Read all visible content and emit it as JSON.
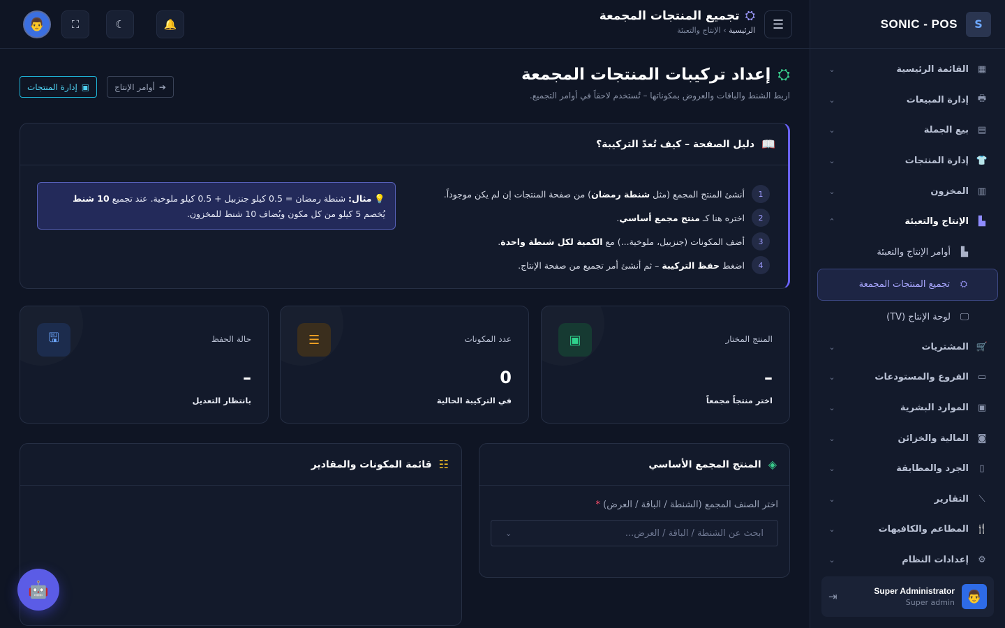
{
  "brand": {
    "name": "SONIC - POS",
    "logo_letter": "S"
  },
  "sidebar": {
    "items": [
      {
        "icon": "▦",
        "label": "القائمة الرئيسية",
        "chevron": "⌄"
      },
      {
        "icon": "🖶",
        "label": "إدارة المبيعات",
        "chevron": "⌄"
      },
      {
        "icon": "▤",
        "label": "بيع الجملة",
        "chevron": "⌄"
      },
      {
        "icon": "👕",
        "label": "إدارة المنتجات",
        "chevron": "⌄"
      },
      {
        "icon": "▥",
        "label": "المخزون",
        "chevron": "⌄"
      },
      {
        "icon": "▙",
        "label": "الإنتاج والتعبئة",
        "chevron": "⌃"
      }
    ],
    "sub_items": [
      {
        "icon": "▙",
        "label": "أوامر الإنتاج والتعبئة"
      },
      {
        "icon": "⛭",
        "label": "تجميع المنتجات المجمعة"
      },
      {
        "icon": "🖵",
        "label": "لوحة الإنتاج (TV)"
      }
    ],
    "items_after": [
      {
        "icon": "🛒",
        "label": "المشتريات",
        "chevron": "⌄"
      },
      {
        "icon": "▭",
        "label": "الفروع والمستودعات",
        "chevron": "⌄"
      },
      {
        "icon": "▣",
        "label": "الموارد البشرية",
        "chevron": "⌄"
      },
      {
        "icon": "◙",
        "label": "المالية والخزائن",
        "chevron": "⌄"
      },
      {
        "icon": "▯",
        "label": "الجرد والمطابقة",
        "chevron": "⌄"
      },
      {
        "icon": "⟋",
        "label": "التقارير",
        "chevron": "⌄"
      },
      {
        "icon": "🍴",
        "label": "المطاعم والكافيهات",
        "chevron": "⌄"
      },
      {
        "icon": "⚙",
        "label": "إعدادات النظام",
        "chevron": "⌄"
      }
    ]
  },
  "user": {
    "name": "Super Administrator",
    "role": "Super admin",
    "avatar": "👨",
    "logout_icon": "⇥"
  },
  "topbar": {
    "menu_icon": "☰",
    "title_icon": "⛭",
    "title": "تجميع المنتجات المجمعة",
    "crumb_home": "الرئيسية",
    "crumb_sep": "›",
    "crumb_current": "الإنتاج والتعبئة",
    "bell_icon": "🔔",
    "moon_icon": "☾",
    "fullscreen_icon": "⛶",
    "avatar": "👨"
  },
  "page": {
    "icon": "⛭",
    "title": "إعداد تركيبات المنتجات المجمعة",
    "subtitle": "اربط الشنط والباقات والعروض بمكوناتها – تُستخدم لاحقاً في أوامر التجميع.",
    "btn_products": "إدارة المنتجات",
    "btn_products_icon": "▣",
    "btn_orders": "أوامر الإنتاج",
    "btn_orders_icon": "➔"
  },
  "guide": {
    "icon": "📖",
    "title": "دليل الصفحة – كيف تُعدّ التركيبة؟",
    "steps": [
      {
        "num": "1",
        "pre": "أنشئ المنتج المجمع (مثل ",
        "bold": "شنطة رمضان",
        "post": ") من صفحة المنتجات إن لم يكن موجوداً."
      },
      {
        "num": "2",
        "pre": "اختره هنا كـ ",
        "bold": "منتج مجمع أساسي",
        "post": "."
      },
      {
        "num": "3",
        "pre": "أضف المكونات (جنزبيل، ملوخية...) مع ",
        "bold": "الكمية لكل شنطة واحدة",
        "post": "."
      },
      {
        "num": "4",
        "pre": "اضغط ",
        "bold": "حفظ التركيبة",
        "post": " – ثم أنشئ أمر تجميع من صفحة الإنتاج."
      }
    ],
    "example_icon": "💡",
    "example_label": "مثال:",
    "example_text1": " شنطة رمضان = 0.5 كيلو جنزبيل + 0.5 كيلو ملوخية. عند تجميع ",
    "example_bold": "10 شنط",
    "example_text2": "يُخصم 5 كيلو من كل مكون ويُضاف 10 شنط للمخزون."
  },
  "stats": [
    {
      "icon": "▣",
      "label": "المنتج المختار",
      "value": "–",
      "note": "اختر منتجاً مجمعاً",
      "color": "#2fd18c",
      "bg": "#163a32"
    },
    {
      "icon": "☰",
      "label": "عدد المكونات",
      "value": "0",
      "note": "في التركيبة الحالية",
      "color": "#f5a524",
      "bg": "#3a2e1d"
    },
    {
      "icon": "🖫",
      "label": "حالة الحفظ",
      "value": "–",
      "note": "بانتظار التعديل",
      "color": "#6ea8ff",
      "bg": "#1c2c4d"
    }
  ],
  "base_card": {
    "icon": "◈",
    "title": "المنتج المجمع الأساسي",
    "field_label": "اختر الصنف المجمع (الشنطة / الباقة / العرض)",
    "required_mark": "*",
    "placeholder": "ابحث عن الشنطة / الباقة / العرض...",
    "dropdown_icon": "⌄"
  },
  "comp_card": {
    "icon": "☷",
    "title": "قائمة المكونات والمقادير"
  },
  "bot_icon": "🤖",
  "colors": {
    "accent": "#6a63ff",
    "cyan": "#1fb6d9",
    "green": "#38c98a"
  }
}
